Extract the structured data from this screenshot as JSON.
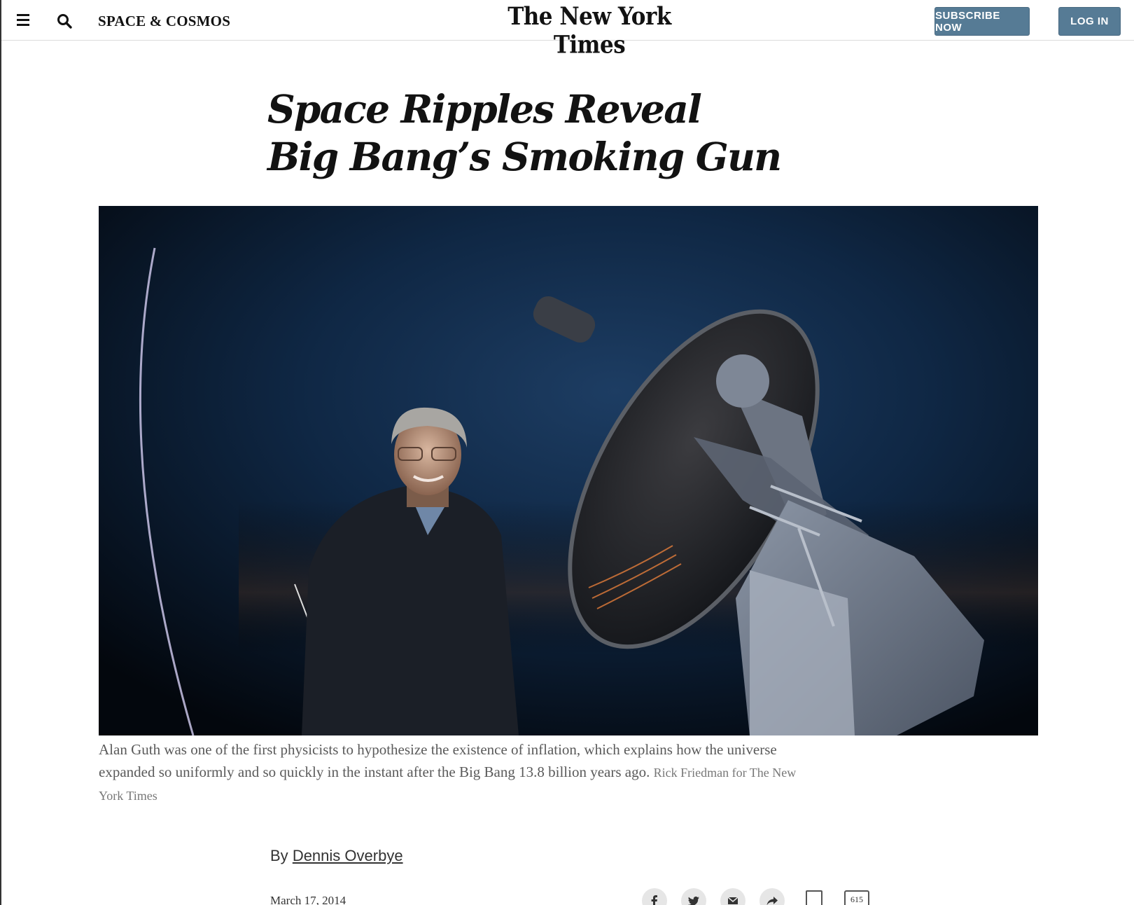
{
  "header": {
    "section": "SPACE & COSMOS",
    "logo": "The New York Times",
    "subscribe_label": "SUBSCRIBE NOW",
    "login_label": "LOG IN"
  },
  "article": {
    "headline_line1": "Space Ripples Reveal",
    "headline_line2": "Big Bang’s Smoking Gun",
    "caption": "Alan Guth was one of the first physicists to hypothesize the existence of inflation, which explains how the universe expanded so uniformly and so quickly in the instant after the Big Bang 13.8 billion years ago.",
    "credit": "Rick Friedman for The New York Times",
    "byline_prefix": "By",
    "author": "Dennis Overbye",
    "date": "March 17, 2014"
  },
  "share_tools": {
    "icons": [
      "facebook-icon",
      "twitter-icon",
      "email-icon",
      "share-icon",
      "bookmark-icon",
      "comment-icon"
    ],
    "comment_count": "615"
  },
  "colors": {
    "button": "#567b95",
    "text": "#121212",
    "caption": "#5a5a5a",
    "sky": "#0b2340"
  }
}
